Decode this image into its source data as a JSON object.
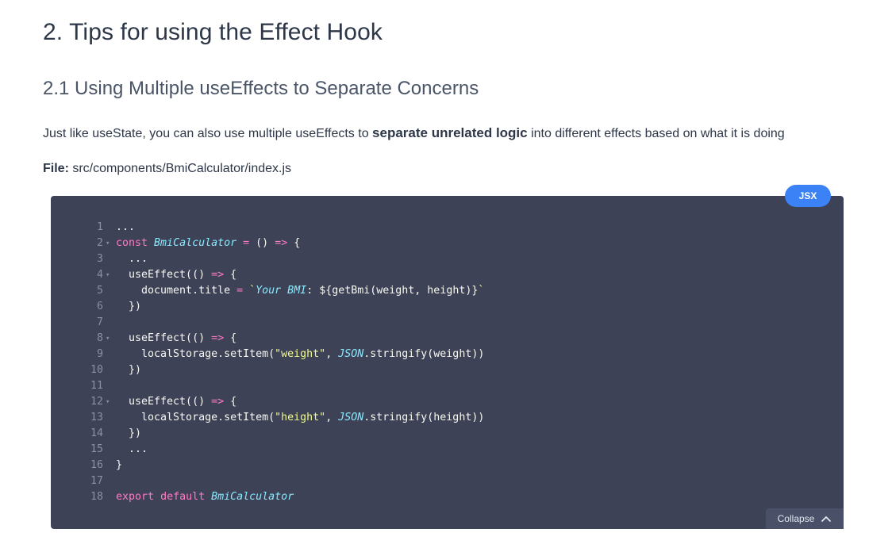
{
  "heading": "2. Tips for using the Effect Hook",
  "subheading": "2.1 Using Multiple useEffects to Separate Concerns",
  "paragraph": {
    "before": "Just like useState, you can also use multiple useEffects to ",
    "bold": "separate unrelated logic",
    "after": " into different effects based on what it is doing"
  },
  "file": {
    "label": "File:",
    "path": "src/components/BmiCalculator/index.js"
  },
  "code": {
    "language": "JSX",
    "collapse_label": "Collapse",
    "lines": [
      {
        "n": "1",
        "fold": false,
        "html": "..."
      },
      {
        "n": "2",
        "fold": true,
        "html": "<span class='t-kw'>const</span> <span class='t-fn'>BmiCalculator</span> <span class='t-op'>=</span> () <span class='t-op'>=&gt;</span> {"
      },
      {
        "n": "3",
        "fold": false,
        "html": "  ..."
      },
      {
        "n": "4",
        "fold": true,
        "html": "  useEffect(() <span class='t-op'>=&gt;</span> {"
      },
      {
        "n": "5",
        "fold": false,
        "html": "    document.title <span class='t-op'>=</span> <span class='t-tpl'>`</span><span class='t-tpl-i'>Your BMI</span>: ${getBmi(weight, height)}<span class='t-tpl'>`</span>"
      },
      {
        "n": "6",
        "fold": false,
        "html": "  })"
      },
      {
        "n": "7",
        "fold": false,
        "html": ""
      },
      {
        "n": "8",
        "fold": true,
        "html": "  useEffect(() <span class='t-op'>=&gt;</span> {"
      },
      {
        "n": "9",
        "fold": false,
        "html": "    localStorage.setItem(<span class='t-str'>\"weight\"</span>, <span class='t-fn'>JSON</span>.stringify(weight))"
      },
      {
        "n": "10",
        "fold": false,
        "html": "  })"
      },
      {
        "n": "11",
        "fold": false,
        "html": ""
      },
      {
        "n": "12",
        "fold": true,
        "html": "  useEffect(() <span class='t-op'>=&gt;</span> {"
      },
      {
        "n": "13",
        "fold": false,
        "html": "    localStorage.setItem(<span class='t-str'>\"height\"</span>, <span class='t-fn'>JSON</span>.stringify(height))"
      },
      {
        "n": "14",
        "fold": false,
        "html": "  })"
      },
      {
        "n": "15",
        "fold": false,
        "html": "  ..."
      },
      {
        "n": "16",
        "fold": false,
        "html": "}"
      },
      {
        "n": "17",
        "fold": false,
        "html": ""
      },
      {
        "n": "18",
        "fold": false,
        "html": "<span class='t-kw'>export</span> <span class='t-kw'>default</span> <span class='t-fn'>BmiCalculator</span>"
      }
    ]
  },
  "colors": {
    "code_bg": "#3d4257",
    "badge": "#3b82f6",
    "keyword": "#ff79c6",
    "identifier": "#8be9fd",
    "string": "#f1fa8c"
  },
  "icons": {
    "fold": "chevron-down-icon",
    "collapse": "chevron-up-icon"
  }
}
